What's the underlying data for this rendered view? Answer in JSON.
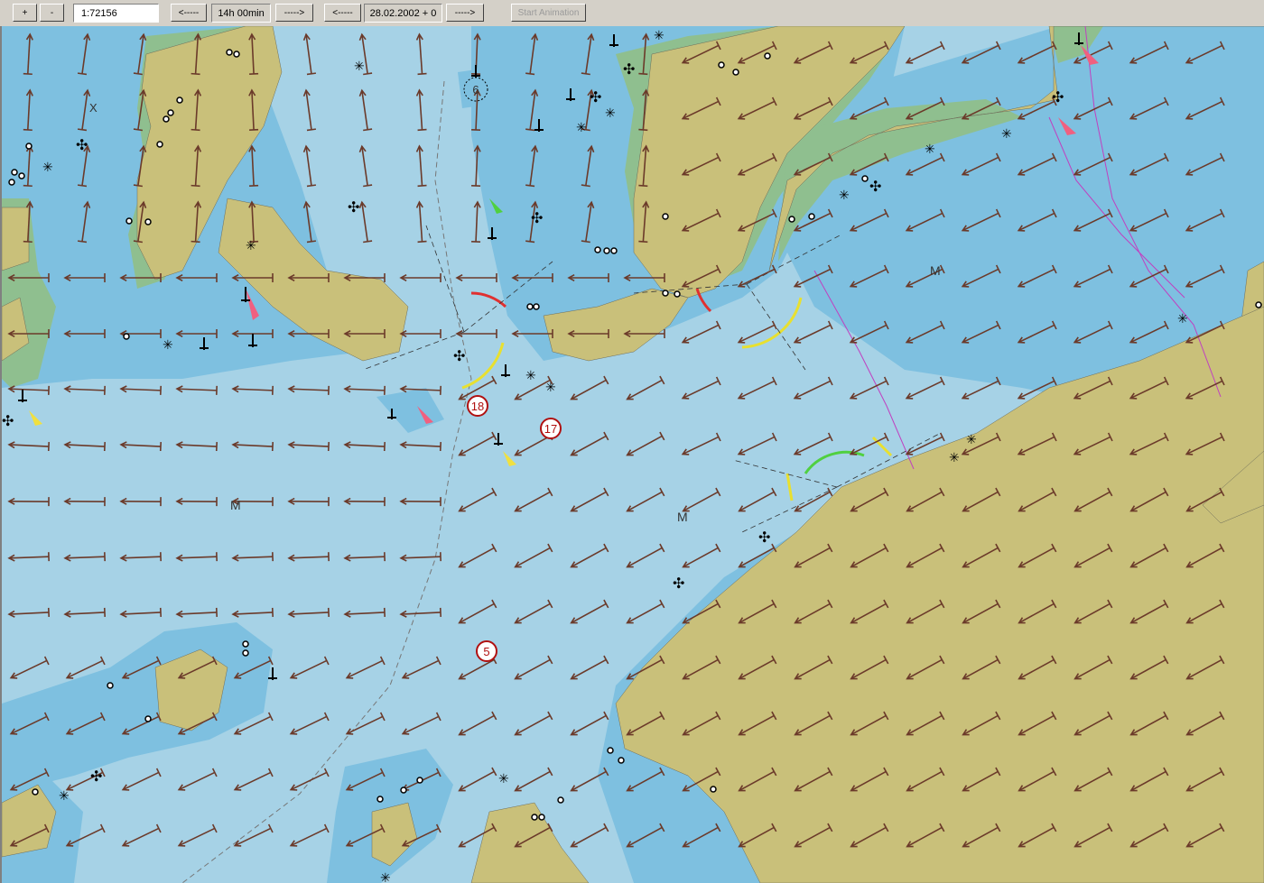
{
  "toolbar": {
    "zoom_in": "+",
    "zoom_out": "-",
    "scale": "1:72156",
    "time_back": "<-----",
    "time_step": "14h 00min",
    "time_fwd": "----->",
    "date_back": "<-----",
    "date_value": "28.02.2002 + 0",
    "date_fwd": "----->",
    "start_animation": "Start Animation"
  },
  "map": {
    "colors": {
      "deep_water": "#a6d2e6",
      "shallow_water": "#7ec0e0",
      "intertidal": "#8fbf8f",
      "land": "#c9c07a",
      "current_arrow": "#6b3a2a"
    },
    "labels": {
      "sounding_6": "6",
      "marker_18": "18",
      "marker_17": "17",
      "marker_5": "5",
      "m1": "M",
      "m2": "M",
      "m3": "M",
      "x1": "X"
    }
  }
}
